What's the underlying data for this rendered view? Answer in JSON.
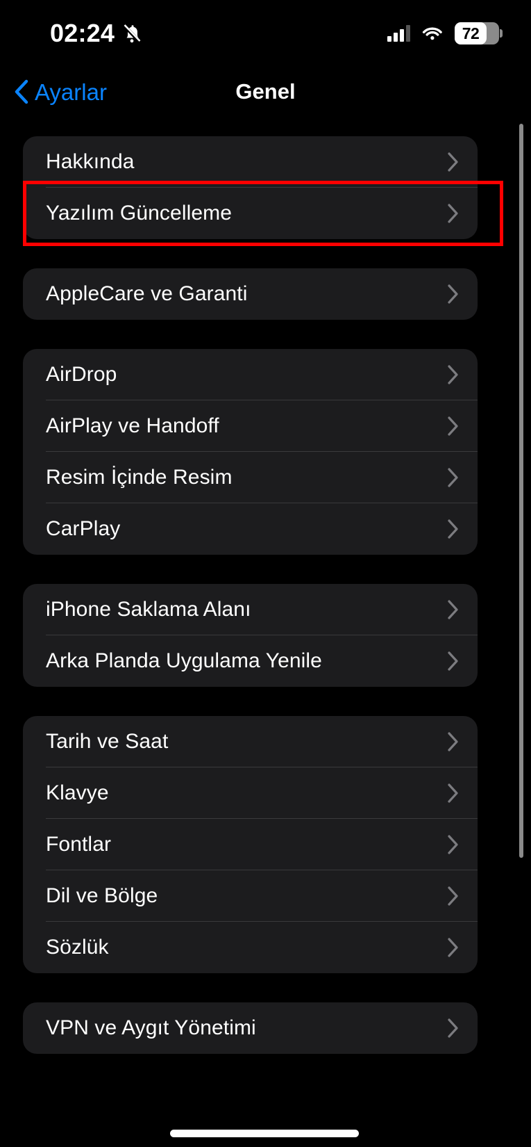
{
  "status_bar": {
    "time": "02:24",
    "silent_icon": "bell-slash-icon",
    "cellular_icon": "cellular-signal-icon",
    "wifi_icon": "wifi-icon",
    "battery_percent": "72",
    "battery_level": 72
  },
  "nav": {
    "back_label": "Ayarlar",
    "back_icon": "chevron-left-icon",
    "title": "Genel"
  },
  "colors": {
    "background": "#000000",
    "card": "#1c1c1e",
    "separator": "#3a3a3c",
    "accent_blue": "#0a84ff",
    "label": "#ffffff",
    "chevron": "#7c7c80",
    "highlight": "#ff0000",
    "scrollbar": "#8a8a8a"
  },
  "groups": [
    {
      "id": "group-device",
      "rows": [
        {
          "label": "Hakkında",
          "chevron": "chevron-right-icon",
          "highlighted": false
        },
        {
          "label": "Yazılım Güncelleme",
          "chevron": "chevron-right-icon",
          "highlighted": true
        }
      ]
    },
    {
      "id": "group-applecare",
      "rows": [
        {
          "label": "AppleCare ve Garanti",
          "chevron": "chevron-right-icon",
          "highlighted": false
        }
      ]
    },
    {
      "id": "group-connectivity",
      "rows": [
        {
          "label": "AirDrop",
          "chevron": "chevron-right-icon",
          "highlighted": false
        },
        {
          "label": "AirPlay ve Handoff",
          "chevron": "chevron-right-icon",
          "highlighted": false
        },
        {
          "label": "Resim İçinde Resim",
          "chevron": "chevron-right-icon",
          "highlighted": false
        },
        {
          "label": "CarPlay",
          "chevron": "chevron-right-icon",
          "highlighted": false
        }
      ]
    },
    {
      "id": "group-storage",
      "rows": [
        {
          "label": "iPhone Saklama Alanı",
          "chevron": "chevron-right-icon",
          "highlighted": false
        },
        {
          "label": "Arka Planda Uygulama Yenile",
          "chevron": "chevron-right-icon",
          "highlighted": false
        }
      ]
    },
    {
      "id": "group-system",
      "rows": [
        {
          "label": "Tarih ve Saat",
          "chevron": "chevron-right-icon",
          "highlighted": false
        },
        {
          "label": "Klavye",
          "chevron": "chevron-right-icon",
          "highlighted": false
        },
        {
          "label": "Fontlar",
          "chevron": "chevron-right-icon",
          "highlighted": false
        },
        {
          "label": "Dil ve Bölge",
          "chevron": "chevron-right-icon",
          "highlighted": false
        },
        {
          "label": "Sözlük",
          "chevron": "chevron-right-icon",
          "highlighted": false
        }
      ]
    },
    {
      "id": "group-vpn",
      "rows": [
        {
          "label": "VPN ve Aygıt Yönetimi",
          "chevron": "chevron-right-icon",
          "highlighted": false
        }
      ]
    }
  ]
}
